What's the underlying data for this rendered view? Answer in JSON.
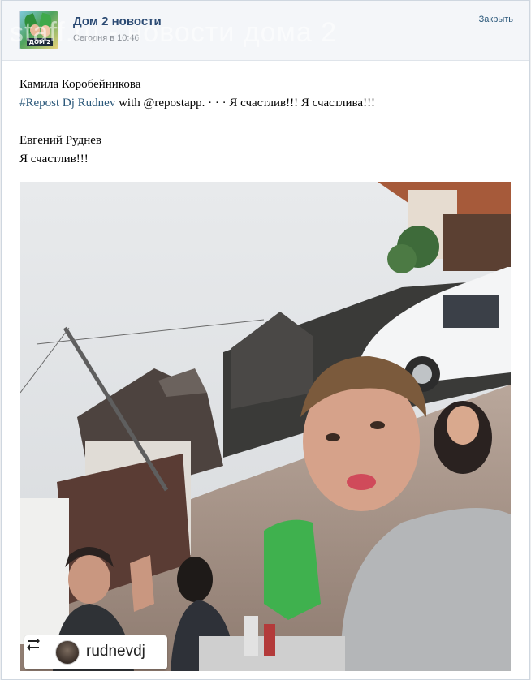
{
  "header": {
    "group_name": "Дом 2 новости",
    "time": "Сегодня в 10:46",
    "close": "Закрыть",
    "avatar_logo": "ДОМ 2",
    "watermark": "staff.ru - новости дома 2"
  },
  "post": {
    "author": "Камила Коробейникова",
    "hashtag": "#Repost Dj Rudnev",
    "repost_tail": " with @repostapp. ·   ·   ·    Я счастлив!!! Я счастлива!!!",
    "quote_author": "Евгений Руднев",
    "quote_text": "Я счастлив!!!"
  },
  "photo": {
    "badge_username": "rudnevdj",
    "icons": [
      "repost-icon",
      "user-avatar"
    ]
  },
  "colors": {
    "link": "#2b587a",
    "group_name": "#2b4a73",
    "muted": "#8a8f96"
  }
}
